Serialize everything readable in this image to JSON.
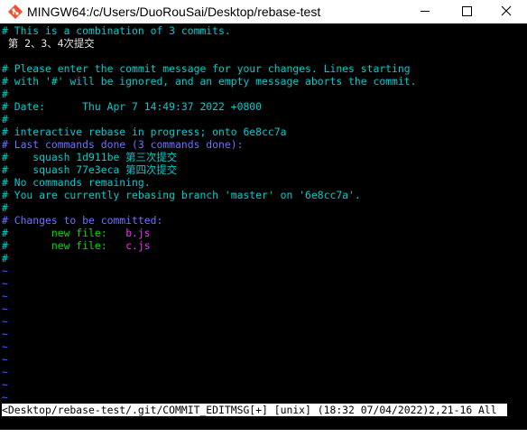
{
  "window": {
    "title": "MINGW64:/c/Users/DuoRouSai/Desktop/rebase-test",
    "icon": "git-bash-icon",
    "minimize_glyph": "─",
    "maximize_glyph": "☐",
    "close_glyph": "✕"
  },
  "colors": {
    "comment": "#00cccc",
    "header": "#7070ff",
    "new_file_label": "#00dd00",
    "filename": "#ee33ee",
    "text": "#e6e6e6",
    "tilde": "#3a6cff"
  },
  "editor": {
    "lines": [
      "# This is a combination of 3 commits.",
      " 第 2、3、4次提交",
      "",
      "# Please enter the commit message for your changes. Lines starting",
      "# with '#' will be ignored, and an empty message aborts the commit.",
      "#",
      "# Date:      Thu Apr 7 14:49:37 2022 +0800",
      "#",
      "# interactive rebase in progress; onto 6e8cc7a",
      "# Last commands done (3 commands done):",
      "#    squash 1d911be 第三次提交",
      "#    squash 77e3eca 第四次提交",
      "# No commands remaining.",
      "# You are currently rebasing branch 'master' on '6e8cc7a'.",
      "#",
      "# Changes to be committed:"
    ],
    "changes": [
      {
        "hash": "#",
        "label": "new file:",
        "file": "b.js"
      },
      {
        "hash": "#",
        "label": "new file:",
        "file": "c.js"
      }
    ],
    "trailing_hash": "#",
    "tildes": [
      "~",
      "~",
      "~",
      "~",
      "~",
      "~",
      "~",
      "~",
      "~",
      "~",
      "~"
    ],
    "status_line": "<Desktop/rebase-test/.git/COMMIT_EDITMSG[+] [unix] (18:32 07/04/2022)2,21-16 All"
  }
}
